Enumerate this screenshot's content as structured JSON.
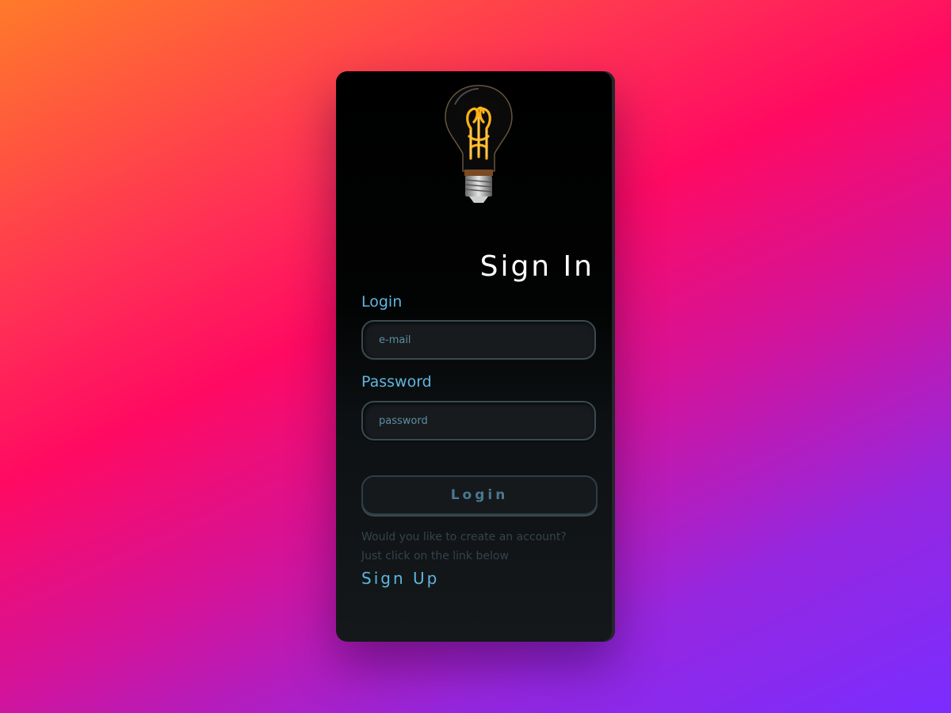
{
  "form": {
    "title": "Sign In",
    "login_label": "Login",
    "email_placeholder": "e-mail",
    "password_label": "Password",
    "password_placeholder": "password",
    "submit_label": "Login",
    "hint_line1": "Would you like to create an account?",
    "hint_line2": "Just click on the link below",
    "signup_label": "Sign Up"
  },
  "colors": {
    "accent": "#5fb6dd",
    "card": "#000000",
    "bg_gradient": [
      "#ff7a2a",
      "#ff0a62",
      "#7a2dff"
    ]
  },
  "icons": {
    "hero": "light-bulb-icon"
  }
}
